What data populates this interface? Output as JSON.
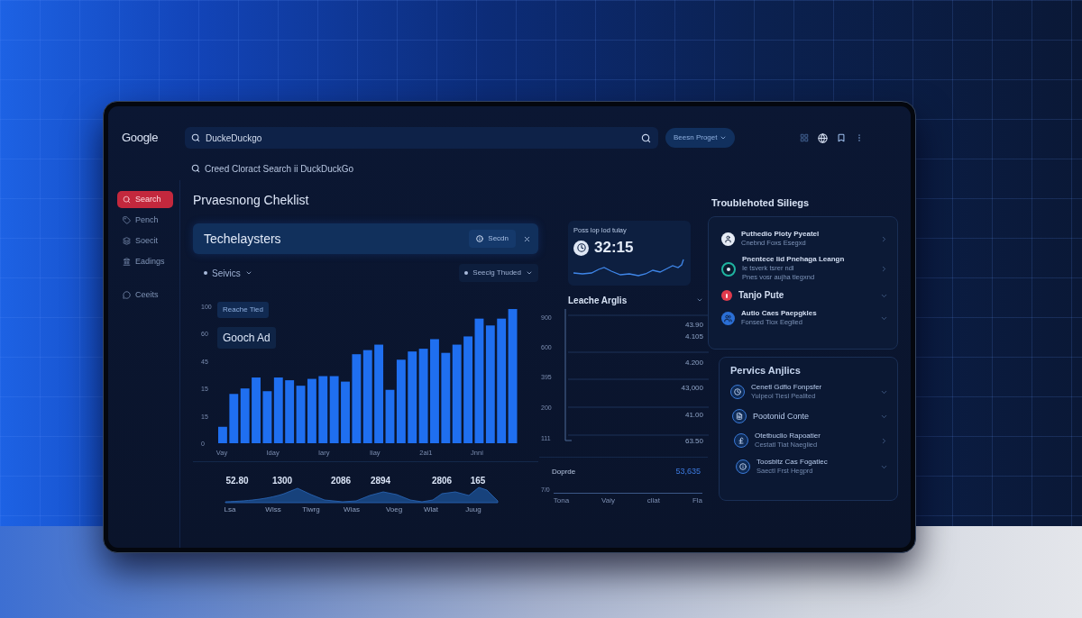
{
  "top_bar": {
    "logo": "Google",
    "search": {
      "value": "DuckeDuckgo"
    },
    "pill": "Beesn Proget",
    "suggestion": "Creed Cloract Search ii DuckDuckGo"
  },
  "sidebar": {
    "items": [
      {
        "label": "Search",
        "selected": true
      },
      {
        "label": "Pench",
        "selected": false
      },
      {
        "label": "Soecit",
        "selected": false
      },
      {
        "label": "Eadings",
        "selected": false
      }
    ],
    "bottom_items": [
      {
        "label": "Ceeits",
        "selected": false
      }
    ]
  },
  "main": {
    "title": "Prvaesnong Cheklist",
    "search_card": {
      "value": "Techelaysters",
      "button": "Secdn"
    },
    "filters": [
      {
        "label": "Seivics"
      },
      {
        "label": "Seecig Thuded"
      }
    ],
    "bar_chart": {
      "legend": [
        "Reache Tied",
        "Gooch Ad"
      ],
      "y_axis_labels": [
        "100",
        "60",
        "45",
        "15",
        "15",
        "0"
      ],
      "x_axis_labels": [
        "Vay",
        "Iday",
        "Iary",
        "Iiay",
        "2ai1",
        "Jnni"
      ]
    },
    "trend_strip": {
      "value_labels": [
        "52.80",
        "1300",
        "2086",
        "2894",
        "2806",
        "165"
      ],
      "x_labels": [
        "Lsa",
        "Wiss",
        "Tiwrg",
        "Wias",
        "Voeg",
        "Wlat",
        "Juug"
      ]
    }
  },
  "middle": {
    "stat_card": {
      "caption": "Poss lop lod tulay",
      "value": "32:15"
    },
    "analytics": {
      "title": "Leache Arglis",
      "axis_labels": [
        "900",
        "600",
        "395",
        "200",
        "111"
      ],
      "value_labels": [
        "43.90",
        "4.105",
        "4.200",
        "43,000",
        "41.00",
        "63.50"
      ]
    },
    "summary": {
      "label": "Doprde",
      "value": "53,635",
      "axis_start": "7/0",
      "x_labels": [
        "Tona",
        "Vaiy",
        "cllat",
        "Fla"
      ]
    }
  },
  "right": {
    "troubleshooting": {
      "title": "Troublehoted Siliegs",
      "items": [
        {
          "kind": "disc",
          "color": "#e6ecf6",
          "title": "Puthedio Ploty Pyeatel",
          "details": [
            "Cnebnd Foxs Esegxd"
          ],
          "expanded": false
        },
        {
          "kind": "ring",
          "color": "#1fb3a0",
          "title": "Pnentece lid Pnehaga Leangn",
          "details": [
            "Ie tsverk tsrer ndl",
            "Pnes vosr aujha tlegxnd"
          ],
          "expanded": false
        },
        {
          "kind": "dot",
          "color": "#e03a4c",
          "title": "Tanjo Pute",
          "expanded": true
        },
        {
          "kind": "disc",
          "color": "#2b6fd6",
          "title": "Autio Caes Paepgkles",
          "details": [
            "Fonsed Tiox Eeglied"
          ],
          "expanded": true
        }
      ]
    },
    "service_analytics": {
      "title": "Pervics Anjlics",
      "items": [
        {
          "title": "Cenetl Gdfio Fonpsfer",
          "details": [
            "Yulpeol Tiesl Pealited"
          ],
          "expanded": true
        },
        {
          "title": "Pootonid Conte",
          "expanded": true
        },
        {
          "title": "Otetbuclio Rapoatier",
          "details": [
            "Cestatl Tiat Naeglied"
          ],
          "expanded": false
        },
        {
          "title": "Toosbltz Cas Fogatlec",
          "details": [
            "Saectl Frst Hegprd"
          ],
          "expanded": true
        }
      ]
    }
  }
}
